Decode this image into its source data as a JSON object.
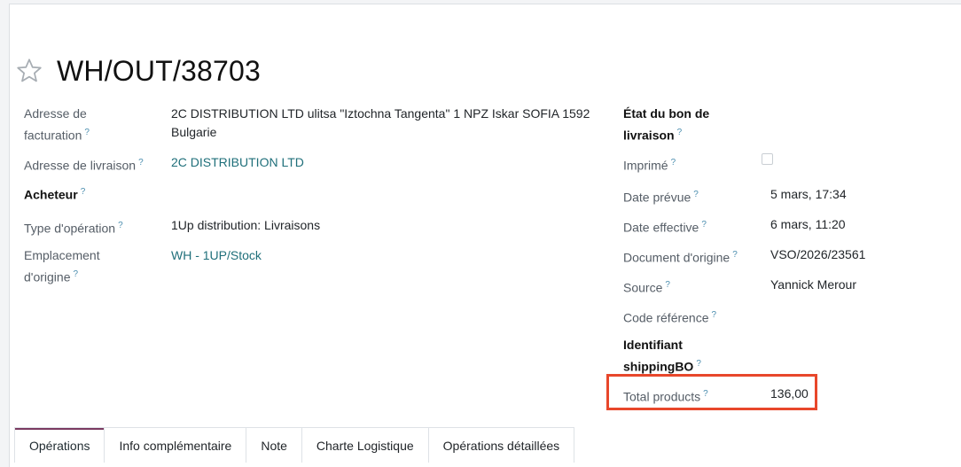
{
  "record": {
    "name": "WH/OUT/38703",
    "favorite_icon": "star-outline-icon"
  },
  "left_fields": {
    "billing_address": {
      "label_line1": "Adresse de",
      "label_line2": "facturation",
      "value_line1": "2C DISTRIBUTION LTD ulitsa \"Iztochna Tangenta\" 1 NPZ Iskar SOFIA 1592",
      "value_line2": "Bulgarie"
    },
    "delivery_address": {
      "label": "Adresse de livraison",
      "value": "2C DISTRIBUTION LTD"
    },
    "buyer": {
      "label": "Acheteur"
    },
    "operation_type": {
      "label": "Type d'opération",
      "value": "1Up distribution: Livraisons"
    },
    "source_location": {
      "label_line1": "Emplacement",
      "label_line2": "d'origine",
      "value": "WH - 1UP/Stock"
    }
  },
  "right_fields": {
    "delivery_state": {
      "label_line1": "État du bon de",
      "label_line2": "livraison"
    },
    "printed": {
      "label": "Imprimé",
      "checked": false
    },
    "scheduled_date": {
      "label": "Date prévue",
      "value": "5 mars, 17:34"
    },
    "effective_date": {
      "label": "Date effective",
      "value": "6 mars, 11:20"
    },
    "origin_document": {
      "label": "Document d'origine",
      "value": "VSO/2026/23561"
    },
    "source": {
      "label": "Source",
      "value": "Yannick Merour"
    },
    "reference_code": {
      "label": "Code référence"
    },
    "shipping_id": {
      "label_line1": "Identifiant",
      "label_line2": "shippingBO"
    },
    "total_products": {
      "label": "Total products",
      "value": "136,00"
    }
  },
  "hint_mark": "?",
  "tabs": [
    {
      "label": "Opérations",
      "active": true
    },
    {
      "label": "Info complémentaire",
      "active": false
    },
    {
      "label": "Note",
      "active": false
    },
    {
      "label": "Charte Logistique",
      "active": false
    },
    {
      "label": "Opérations détaillées",
      "active": false
    }
  ],
  "colors": {
    "link": "#1f6f7a",
    "hint": "#4d8fb0",
    "highlight": "#e8472b"
  }
}
